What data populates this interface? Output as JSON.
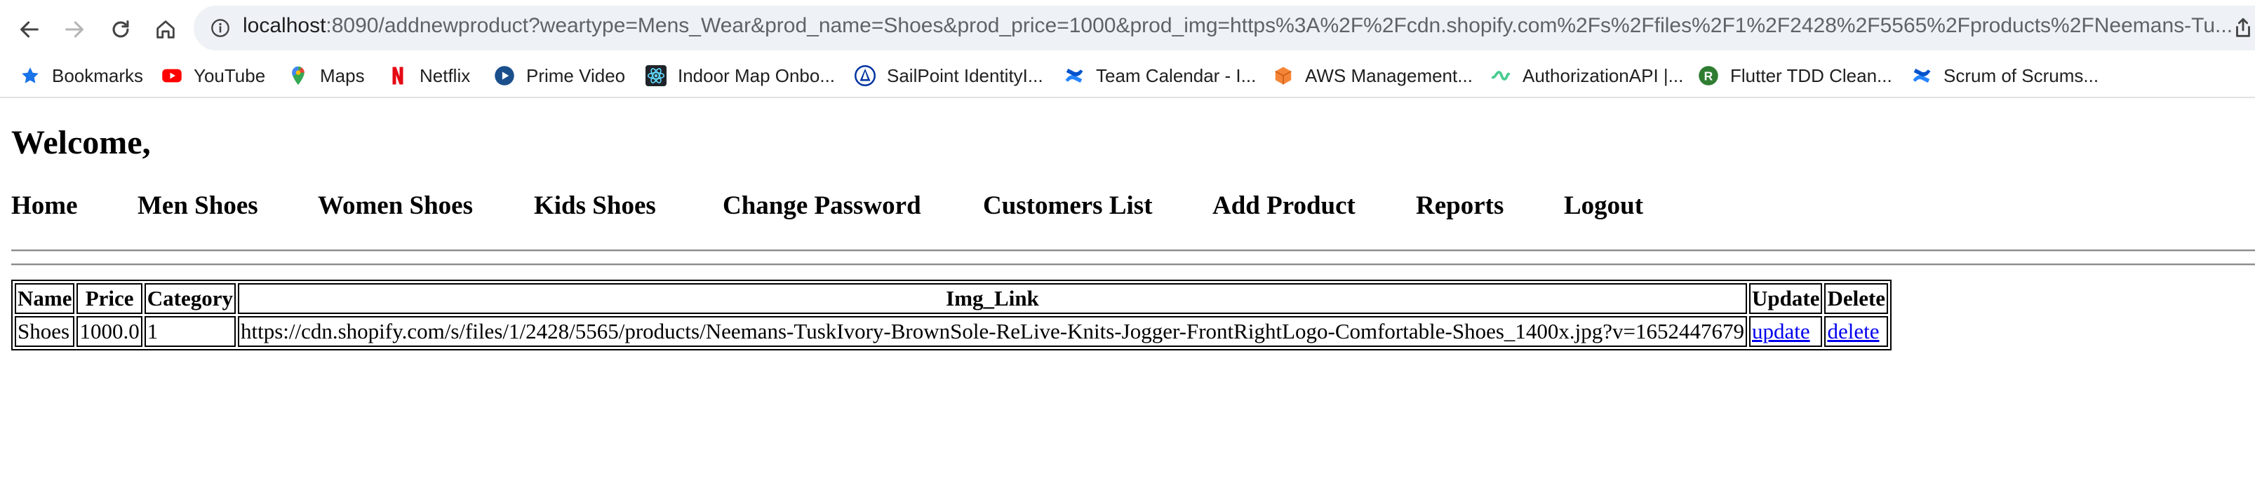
{
  "browser": {
    "url_host": "localhost",
    "url_rest": ":8090/addnewproduct?weartype=Mens_Wear&prod_name=Shoes&prod_price=1000&prod_img=https%3A%2F%2Fcdn.shopify.com%2Fs%2Ffiles%2F1%2F2428%2F5565%2Fproducts%2FNeemans-Tu...",
    "bookmarks": [
      {
        "label": "Bookmarks",
        "icon": "star-icon",
        "color": "#1a73e8"
      },
      {
        "label": "YouTube",
        "icon": "youtube-icon",
        "color": "#ff0000"
      },
      {
        "label": "Maps",
        "icon": "maps-pin-icon",
        "color": "#34a853"
      },
      {
        "label": "Netflix",
        "icon": "netflix-icon",
        "color": "#e50914"
      },
      {
        "label": "Prime Video",
        "icon": "prime-video-icon",
        "color": "#1a98ff"
      },
      {
        "label": "Indoor Map Onbo...",
        "icon": "react-icon",
        "color": "#61dafb"
      },
      {
        "label": "SailPoint IdentityI...",
        "icon": "sailpoint-icon",
        "color": "#0033a1"
      },
      {
        "label": "Team Calendar - I...",
        "icon": "confluence-icon",
        "color": "#2684ff"
      },
      {
        "label": "AWS Management...",
        "icon": "aws-cube-icon",
        "color": "#f58536"
      },
      {
        "label": "AuthorizationAPI |...",
        "icon": "swagger-icon",
        "color": "#49cc90"
      },
      {
        "label": "Flutter TDD Clean...",
        "icon": "flutter-r-icon",
        "color": "#2e7d32"
      },
      {
        "label": "Scrum of Scrums...",
        "icon": "confluence-icon",
        "color": "#2684ff"
      }
    ]
  },
  "page": {
    "welcome": "Welcome,",
    "nav": [
      "Home",
      "Men Shoes",
      "Women Shoes",
      "Kids Shoes",
      "Change Password",
      "Customers List",
      "Add Product",
      "Reports",
      "Logout"
    ]
  },
  "table": {
    "headers": [
      "Name",
      "Price",
      "Category",
      "Img_Link",
      "Update",
      "Delete"
    ],
    "rows": [
      {
        "name": "Shoes",
        "price": "1000.0",
        "category": "1",
        "img_link": "https://cdn.shopify.com/s/files/1/2428/5565/products/Neemans-TuskIvory-BrownSole-ReLive-Knits-Jogger-FrontRightLogo-Comfortable-Shoes_1400x.jpg?v=1652447679",
        "update": "update",
        "delete": "delete"
      }
    ]
  }
}
